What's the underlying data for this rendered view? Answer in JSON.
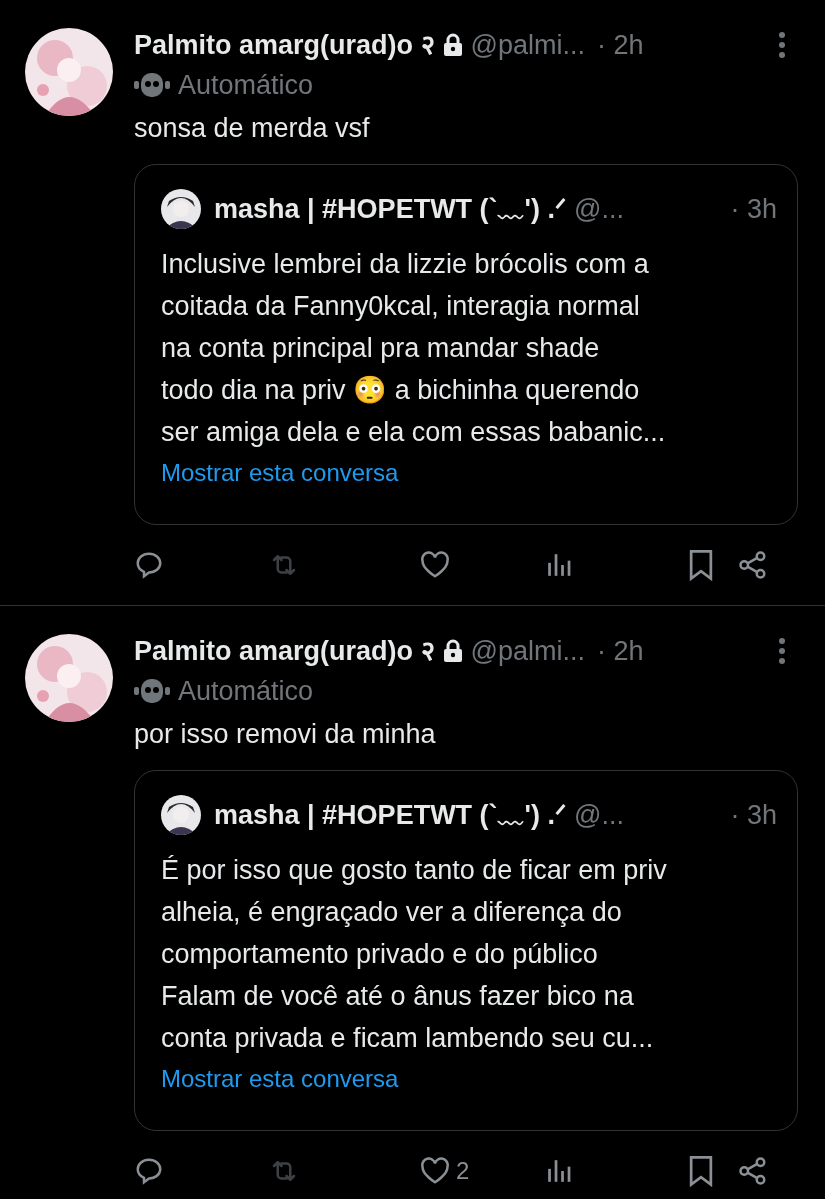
{
  "tweets": [
    {
      "name": "Palmito amarg(urad)o २",
      "protected": true,
      "handle": "@palmi...",
      "time": "· 2h",
      "label": "Automático",
      "text": "sonsa de merda vsf",
      "quote": {
        "name": "masha | #HOPETWT (`﹏') .ᐟ",
        "handle": "@...",
        "time": "· 3h",
        "lines": [
          "Inclusive lembrei da lizzie brócolis com a",
          "coitada da Fanny0kcal, interagia normal",
          "na conta principal pra mandar shade",
          "todo dia na priv 😳 a bichinha querendo",
          "ser amiga dela e ela com essas babanic..."
        ],
        "link": "Mostrar esta conversa"
      },
      "actions": {
        "retweet_disabled": true
      }
    },
    {
      "name": "Palmito amarg(urad)o २",
      "protected": true,
      "handle": "@palmi...",
      "time": "· 2h",
      "label": "Automático",
      "text": "por isso removi da minha",
      "quote": {
        "name": "masha | #HOPETWT (`﹏') .ᐟ",
        "handle": "@...",
        "time": "· 3h",
        "lines": [
          "É por isso que gosto tanto de ficar em priv",
          "alheia, é engraçado ver a diferença do",
          "comportamento privado e do público",
          "Falam de você até o ânus fazer bico na",
          "conta privada e ficam lambendo seu cu..."
        ],
        "link": "Mostrar esta conversa"
      },
      "actions": {
        "retweet_disabled": true,
        "likes": "2"
      }
    }
  ]
}
